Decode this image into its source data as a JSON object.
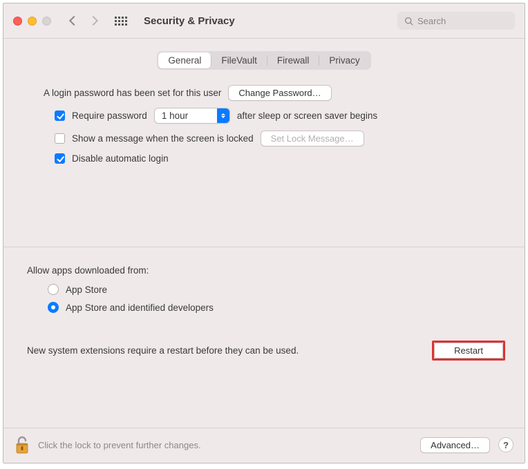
{
  "header": {
    "title": "Security & Privacy",
    "search_placeholder": "Search"
  },
  "tabs": {
    "items": [
      "General",
      "FileVault",
      "Firewall",
      "Privacy"
    ],
    "active_index": 0
  },
  "login": {
    "password_set_label": "A login password has been set for this user",
    "change_password_label": "Change Password…",
    "require_password": {
      "checked": true,
      "label_pre": "Require password",
      "dropdown_value": "1 hour",
      "label_post": "after sleep or screen saver begins"
    },
    "show_message": {
      "checked": false,
      "label": "Show a message when the screen is locked",
      "set_lock_label": "Set Lock Message…"
    },
    "disable_auto_login": {
      "checked": true,
      "label": "Disable automatic login"
    }
  },
  "allow_apps": {
    "title": "Allow apps downloaded from:",
    "options": [
      "App Store",
      "App Store and identified developers"
    ],
    "selected_index": 1
  },
  "extensions_notice": {
    "text": "New system extensions require a restart before they can be used.",
    "button_label": "Restart"
  },
  "footer": {
    "lock_text": "Click the lock to prevent further changes.",
    "advanced_label": "Advanced…",
    "help_label": "?"
  }
}
